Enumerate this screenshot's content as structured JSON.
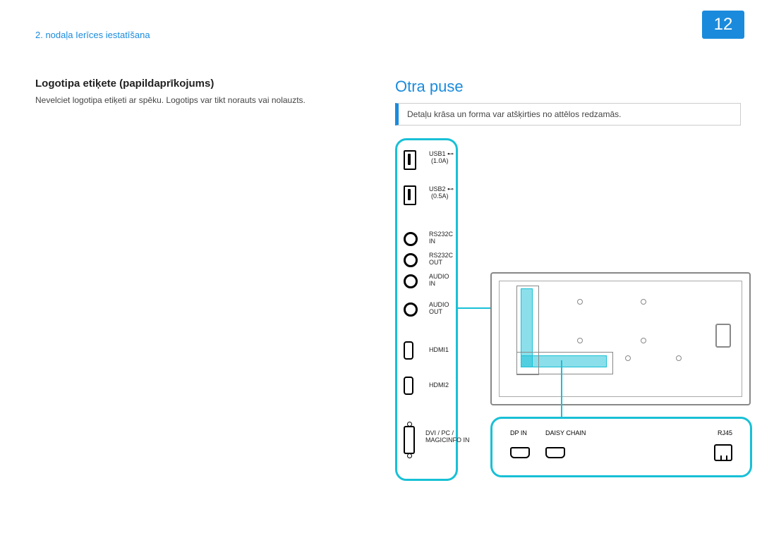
{
  "page_number": "12",
  "chapter_label": "2. nodaļa Ierīces iestatīšana",
  "left": {
    "heading": "Logotipa etiķete (papildaprīkojums)",
    "body": "Nevelciet logotipa etiķeti ar spēku. Logotips var tikt norauts vai nolauzts."
  },
  "right": {
    "heading": "Otra puse",
    "notice": "Detaļu krāsa un forma var atšķirties no attēlos redzamās."
  },
  "side_ports": {
    "usb1": "USB1 ⊷",
    "usb1_sub": "(1.0A)",
    "usb2": "USB2 ⊷",
    "usb2_sub": "(0.5A)",
    "rs232c_in": "RS232C\nIN",
    "rs232c_out": "RS232C\nOUT",
    "audio_in": "AUDIO\nIN",
    "audio_out": "AUDIO\nOUT",
    "hdmi1": "HDMI1",
    "hdmi2": "HDMI2",
    "dvi": "DVI / PC /\nMAGICINFO IN"
  },
  "bottom_ports": {
    "dp_in": "DP IN",
    "daisy_chain": "DAISY CHAIN",
    "rj45": "RJ45"
  }
}
